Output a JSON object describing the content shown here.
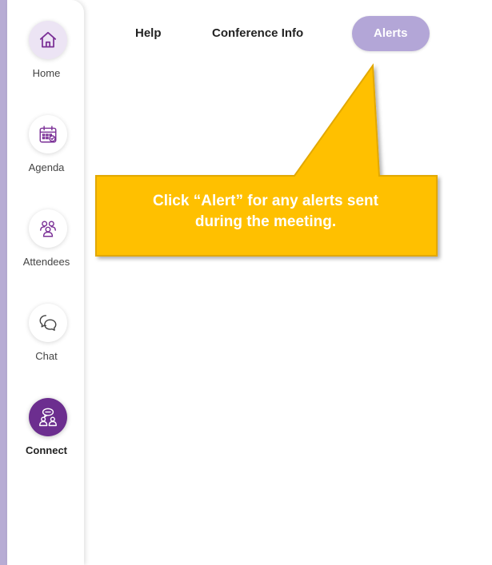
{
  "sidebar": {
    "items": [
      {
        "label": "Home",
        "icon": "home-icon"
      },
      {
        "label": "Agenda",
        "icon": "calendar-icon"
      },
      {
        "label": "Attendees",
        "icon": "people-icon"
      },
      {
        "label": "Chat",
        "icon": "chat-bubbles-icon"
      },
      {
        "label": "Connect",
        "icon": "connect-icon",
        "active": true
      }
    ]
  },
  "top_nav": {
    "links": [
      {
        "label": "Help"
      },
      {
        "label": "Conference Info"
      },
      {
        "label": "Alerts",
        "active": true
      }
    ]
  },
  "callout": {
    "text_line1": "Click “Alert” for any alerts sent",
    "text_line2": "during the meeting."
  },
  "colors": {
    "accent_purple": "#6c2e8f",
    "pill_lavender": "#b3a6d7",
    "callout_yellow": "#ffc000",
    "callout_border": "#e2a800"
  }
}
